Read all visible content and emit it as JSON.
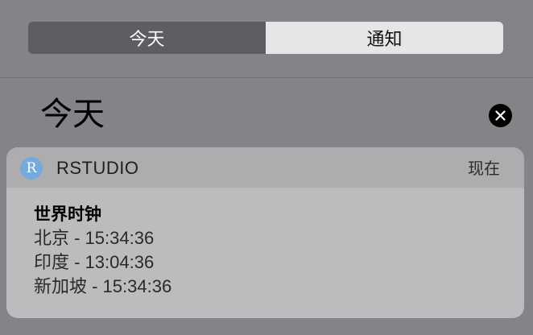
{
  "tabs": {
    "today_label": "今天",
    "notifications_label": "通知",
    "active": "today"
  },
  "section": {
    "title": "今天"
  },
  "notification": {
    "app_name": "RSTUDIO",
    "app_icon_letter": "R",
    "time": "现在",
    "title": "世界时钟",
    "lines": [
      "北京 - 15:34:36",
      "印度 - 13:04:36",
      "新加坡 - 15:34:36"
    ]
  },
  "colors": {
    "background": "#848387",
    "active_tab": "#5e5d62",
    "inactive_tab": "#e6e5e7",
    "app_icon": "#75aadb",
    "card": "#bcbcbe",
    "card_header": "#adadb0"
  },
  "icons": {
    "clear": "close-icon",
    "app": "rstudio-app-icon"
  }
}
